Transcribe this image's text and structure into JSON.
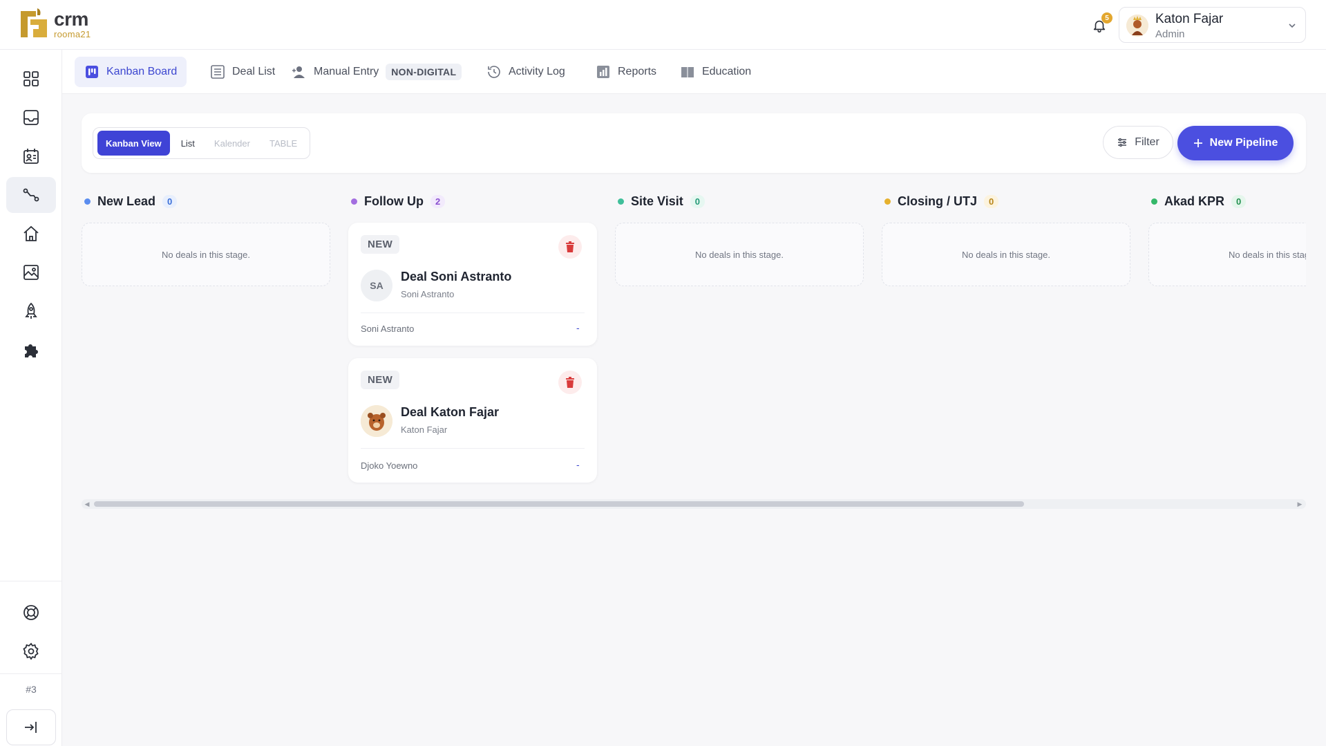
{
  "header": {
    "logo_text": "crm",
    "logo_sub": "rooma21",
    "notification_count": "5",
    "user_name": "Katon Fajar",
    "user_role": "Admin"
  },
  "sidebar": {
    "items": [
      {
        "icon": "grid-icon"
      },
      {
        "icon": "inbox-icon"
      },
      {
        "icon": "contacts-icon"
      },
      {
        "icon": "pipeline-icon",
        "active": true
      },
      {
        "icon": "home-icon"
      },
      {
        "icon": "gallery-icon"
      },
      {
        "icon": "rocket-icon"
      },
      {
        "icon": "puzzle-icon"
      }
    ],
    "bottom": [
      {
        "icon": "support-icon"
      },
      {
        "icon": "settings-icon"
      }
    ],
    "number": "#3",
    "logout_icon": "logout-icon"
  },
  "nav": {
    "tabs": [
      {
        "label": "Kanban Board",
        "icon": "kanban-icon",
        "active": true
      },
      {
        "label": "Deal List",
        "icon": "list-icon"
      },
      {
        "label": "Manual Entry",
        "icon": "user-add-icon",
        "badge": "NON-DIGITAL"
      },
      {
        "label": "Activity Log",
        "icon": "history-icon"
      },
      {
        "label": "Reports",
        "icon": "chart-icon"
      },
      {
        "label": "Education",
        "icon": "book-icon"
      }
    ]
  },
  "toolbar": {
    "views": [
      {
        "label": "Kanban View",
        "state": "active"
      },
      {
        "label": "List",
        "state": "normal"
      },
      {
        "label": "Kalender",
        "state": "disabled"
      },
      {
        "label": "TABLE",
        "state": "disabled"
      }
    ],
    "filter_label": "Filter",
    "new_pipeline_label": "New Pipeline"
  },
  "board": {
    "empty_text": "No deals in this stage.",
    "columns": [
      {
        "name": "New Lead",
        "count": "0",
        "color": "#5b8def",
        "badge_bg": "#e8effd",
        "badge_fg": "#3b6fd8"
      },
      {
        "name": "Follow Up",
        "count": "2",
        "color": "#a36ee0",
        "badge_bg": "#f2eafc",
        "badge_fg": "#8a4fd0"
      },
      {
        "name": "Site Visit",
        "count": "0",
        "color": "#3fbf9a",
        "badge_bg": "#e6f7f1",
        "badge_fg": "#239a77"
      },
      {
        "name": "Closing / UTJ",
        "count": "0",
        "color": "#e6b12e",
        "badge_bg": "#fcf3de",
        "badge_fg": "#b8861a"
      },
      {
        "name": "Akad KPR",
        "count": "0",
        "color": "#35b86a",
        "badge_bg": "#e5f6ec",
        "badge_fg": "#23904f"
      }
    ],
    "cards": [
      {
        "tag": "NEW",
        "initials": "SA",
        "title": "Deal Soni Astranto",
        "subtitle": "Soni Astranto",
        "owner": "Soni Astranto",
        "value": "-"
      },
      {
        "tag": "NEW",
        "initials": "",
        "title": "Deal Katon Fajar",
        "subtitle": "Katon Fajar",
        "owner": "Djoko Yoewno",
        "value": "-"
      }
    ]
  }
}
